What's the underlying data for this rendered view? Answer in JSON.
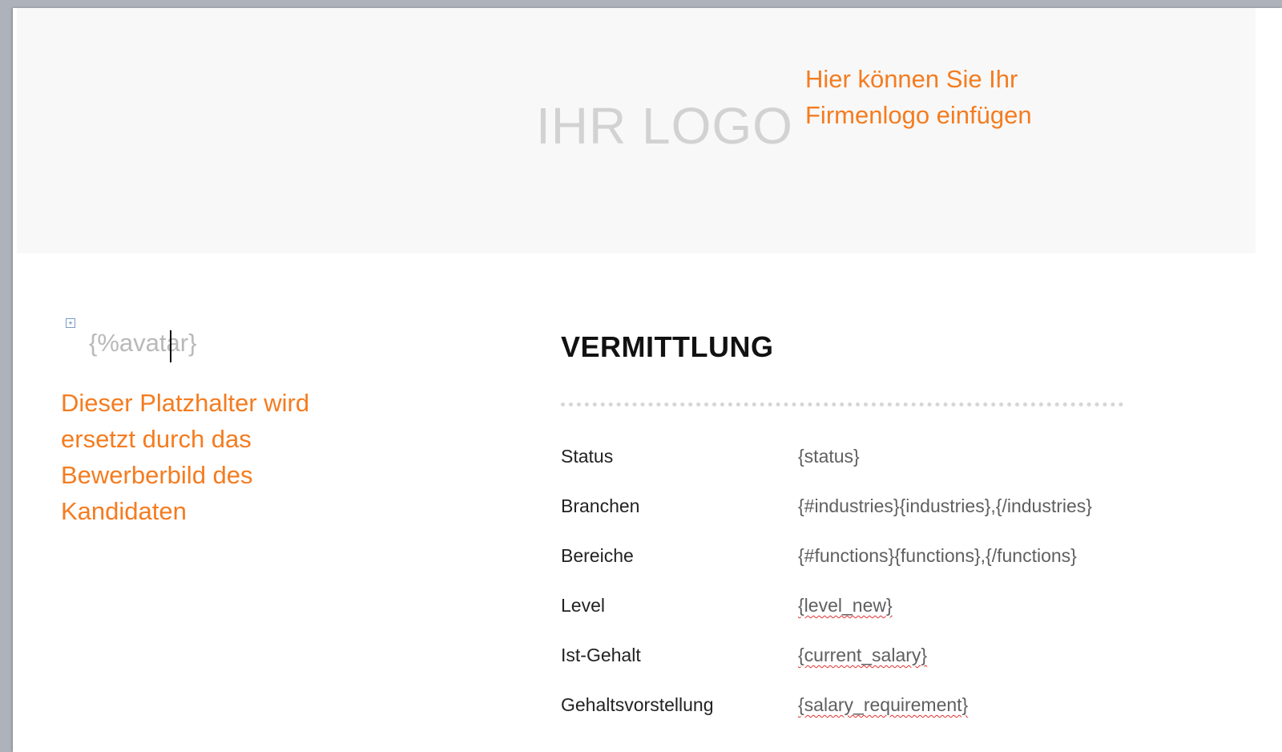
{
  "header": {
    "logo_placeholder": "IHR LOGO",
    "logo_note_line1": "Hier können Sie Ihr",
    "logo_note_line2": "Firmenlogo einfügen"
  },
  "avatar": {
    "placeholder_part1": "{%avat",
    "placeholder_part2": "ar}",
    "note_lines": [
      "Dieser Platzhalter wird",
      "ersetzt durch das",
      "Bewerberbild des",
      "Kandidaten"
    ]
  },
  "section": {
    "title": "VERMITTLUNG"
  },
  "fields": [
    {
      "label": "Status",
      "value": "{status}"
    },
    {
      "label": "Branchen",
      "value": "{#industries}{industries},{/industries}"
    },
    {
      "label": "Bereiche",
      "value": "{#functions}{functions},{/functions}"
    },
    {
      "label": "Level",
      "value": "{level_new}"
    },
    {
      "label": "Ist-Gehalt",
      "value": "{current_salary}"
    },
    {
      "label": "Gehaltsvorstellung",
      "value": "{salary_requirement}"
    }
  ],
  "colors": {
    "note_orange": "#f47c20",
    "placeholder_gray": "#b9b9b9",
    "logo_gray": "#d2d2d2"
  }
}
